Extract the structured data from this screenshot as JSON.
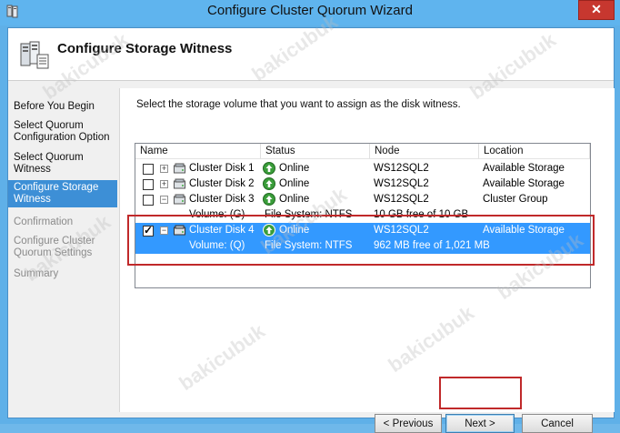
{
  "window": {
    "title": "Configure Cluster Quorum Wizard",
    "close_label": "✕"
  },
  "header": {
    "title": "Configure Storage Witness"
  },
  "nav": {
    "items": [
      {
        "label": "Before You Begin"
      },
      {
        "label": "Select Quorum Configuration Option"
      },
      {
        "label": "Select Quorum Witness"
      },
      {
        "label": "Configure Storage Witness"
      },
      {
        "label": "Confirmation"
      },
      {
        "label": "Configure Cluster Quorum Settings"
      },
      {
        "label": "Summary"
      }
    ]
  },
  "content": {
    "instruction": "Select the storage volume that you want to assign as the disk witness."
  },
  "table": {
    "columns": [
      "Name",
      "Status",
      "Node",
      "Location"
    ],
    "rows": [
      {
        "name": "Cluster Disk 1",
        "expander": "+",
        "checked": false,
        "status": "Online",
        "node": "WS12SQL2",
        "location": "Available Storage"
      },
      {
        "name": "Cluster Disk 2",
        "expander": "+",
        "checked": false,
        "status": "Online",
        "node": "WS12SQL2",
        "location": "Available Storage"
      },
      {
        "name": "Cluster Disk 3",
        "expander": "−",
        "checked": false,
        "status": "Online",
        "node": "WS12SQL2",
        "location": "Cluster Group"
      },
      {
        "volume": "Volume: (G)",
        "filesystem": "File System: NTFS",
        "free": "10 GB free of 10 GB"
      },
      {
        "name": "Cluster Disk 4",
        "expander": "−",
        "checked": true,
        "status": "Online",
        "node": "WS12SQL2",
        "location": "Available Storage"
      },
      {
        "volume": "Volume: (Q)",
        "filesystem": "File System: NTFS",
        "free": "962 MB free of 1,021 MB"
      }
    ]
  },
  "buttons": {
    "previous": "< Previous",
    "next": "Next >",
    "cancel": "Cancel"
  },
  "watermark": "bakicubuk",
  "colors": {
    "titlebar": "#5fb4ee",
    "selection": "#3399ff",
    "nav_active": "#3d8fd6",
    "highlight_box": "#c0292a",
    "close_button": "#c7372f"
  }
}
